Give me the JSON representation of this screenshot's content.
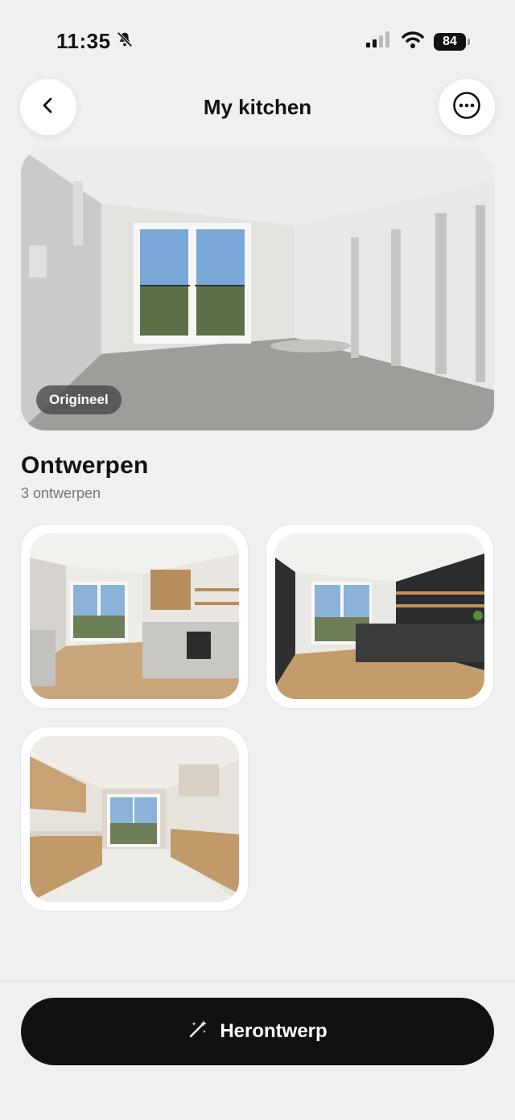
{
  "status_bar": {
    "time": "11:35",
    "battery": "84"
  },
  "header": {
    "title": "My kitchen"
  },
  "original": {
    "badge": "Origineel"
  },
  "designs": {
    "title": "Ontwerpen",
    "count_label": "3 ontwerpen"
  },
  "actions": {
    "redesign_label": "Herontwerp"
  },
  "colors": {
    "background": "#f0f0f2",
    "primary_button": "#111111"
  }
}
